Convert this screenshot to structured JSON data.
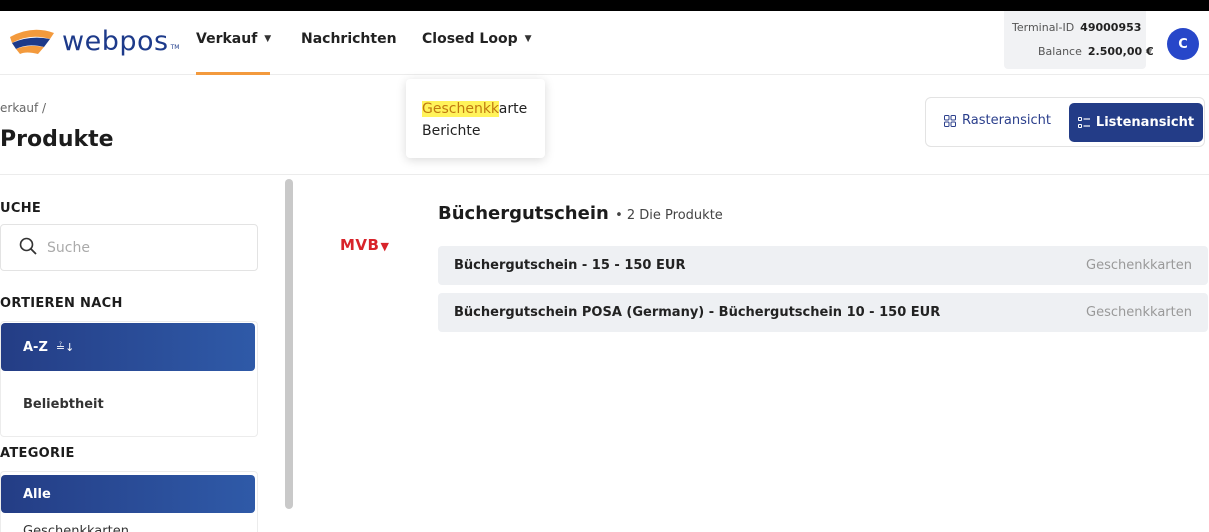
{
  "app": {
    "logo_text": "webpos",
    "logo_tm": "TM",
    "colors": {
      "brand_blue": "#1d3a8a",
      "accent_orange": "#f39a3d",
      "primary_dark": "#233c87",
      "highlight": "#fff35a",
      "mvb_red": "#d8232a"
    }
  },
  "nav": {
    "items": [
      {
        "label": "Verkauf",
        "has_caret": true,
        "active": true
      },
      {
        "label": "Nachrichten",
        "has_caret": false,
        "active": false
      },
      {
        "label": "Closed Loop",
        "has_caret": true,
        "active": false
      }
    ]
  },
  "terminal": {
    "id_label": "Terminal-ID",
    "id_value": "49000953",
    "balance_label": "Balance",
    "balance_value": "2.500,00 €"
  },
  "user": {
    "avatar_initial": "C"
  },
  "dropdown": {
    "item1_highlight": "Geschenkk",
    "item1_rest": "arte",
    "item2": "Berichte"
  },
  "page": {
    "breadcrumb": "erkauf /",
    "title": "Produkte"
  },
  "view_toggle": {
    "raster_label": "Rasteransicht",
    "list_label": "Listenansicht",
    "active": "list"
  },
  "sidebar": {
    "search_label": "UCHE",
    "search_placeholder": "Suche",
    "sort_label": "ORTIEREN NACH",
    "sort_options": [
      {
        "label": "A-Z",
        "icon": "sort-alpha-icon",
        "active": true
      },
      {
        "label": "Beliebtheit",
        "active": false
      }
    ],
    "category_label": "ATEGORIE",
    "categories": [
      {
        "label": "Alle",
        "active": true
      },
      {
        "label": "Geschenkkarten",
        "active": false
      }
    ]
  },
  "main": {
    "brand_logo": "MVB",
    "group_title": "Büchergutschein",
    "group_count": "• 2 Die Produkte",
    "products": [
      {
        "name": "Büchergutschein - 15 - 150 EUR",
        "category": "Geschenkkarten"
      },
      {
        "name": "Büchergutschein POSA (Germany) - Büchergutschein 10 - 150 EUR",
        "category": "Geschenkkarten"
      }
    ]
  }
}
